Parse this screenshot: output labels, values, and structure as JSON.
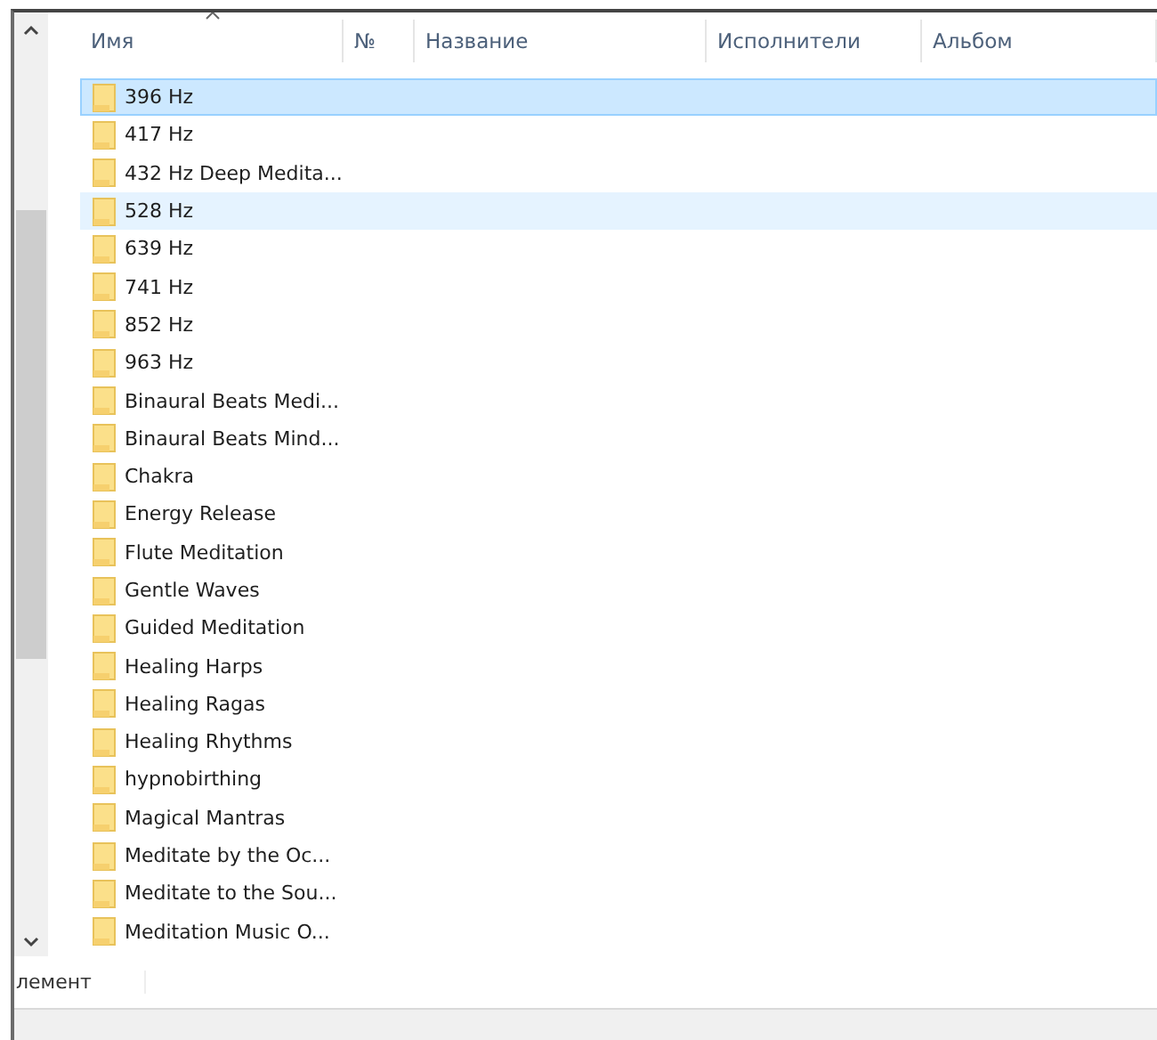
{
  "columns": [
    {
      "label": "Имя",
      "sorted": true
    },
    {
      "label": "№",
      "sorted": false
    },
    {
      "label": "Название",
      "sorted": false
    },
    {
      "label": "Исполнители",
      "sorted": false
    },
    {
      "label": "Альбом",
      "sorted": false
    }
  ],
  "rows": [
    {
      "name": "396 Hz",
      "selected": true,
      "hovered": false
    },
    {
      "name": "417 Hz",
      "selected": false,
      "hovered": false
    },
    {
      "name": "432 Hz Deep Medita...",
      "selected": false,
      "hovered": false
    },
    {
      "name": "528 Hz",
      "selected": false,
      "hovered": true
    },
    {
      "name": "639 Hz",
      "selected": false,
      "hovered": false
    },
    {
      "name": "741 Hz",
      "selected": false,
      "hovered": false
    },
    {
      "name": "852 Hz",
      "selected": false,
      "hovered": false
    },
    {
      "name": "963 Hz",
      "selected": false,
      "hovered": false
    },
    {
      "name": "Binaural Beats Medi...",
      "selected": false,
      "hovered": false
    },
    {
      "name": "Binaural Beats Mind...",
      "selected": false,
      "hovered": false
    },
    {
      "name": "Chakra",
      "selected": false,
      "hovered": false
    },
    {
      "name": "Energy Release",
      "selected": false,
      "hovered": false
    },
    {
      "name": "Flute Meditation",
      "selected": false,
      "hovered": false
    },
    {
      "name": "Gentle Waves",
      "selected": false,
      "hovered": false
    },
    {
      "name": "Guided Meditation",
      "selected": false,
      "hovered": false
    },
    {
      "name": "Healing Harps",
      "selected": false,
      "hovered": false
    },
    {
      "name": "Healing Ragas",
      "selected": false,
      "hovered": false
    },
    {
      "name": "Healing Rhythms",
      "selected": false,
      "hovered": false
    },
    {
      "name": "hypnobirthing",
      "selected": false,
      "hovered": false
    },
    {
      "name": "Magical Mantras",
      "selected": false,
      "hovered": false
    },
    {
      "name": "Meditate by the Oc...",
      "selected": false,
      "hovered": false
    },
    {
      "name": "Meditate to the Sou...",
      "selected": false,
      "hovered": false
    },
    {
      "name": "Meditation Music O...",
      "selected": false,
      "hovered": false
    }
  ],
  "status_bar": {
    "text": "лемент"
  }
}
